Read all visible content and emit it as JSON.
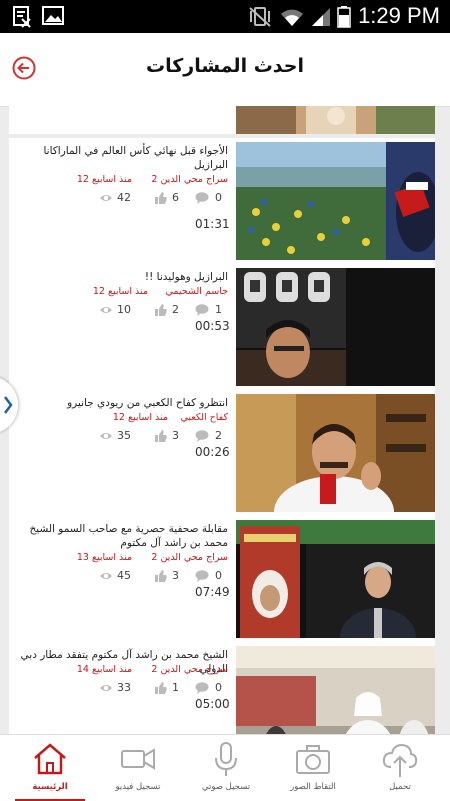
{
  "status_bar": {
    "time": "1:29 PM"
  },
  "header": {
    "title": "احدث المشاركات"
  },
  "posts": [
    {
      "title": "الأجواء قبل نهائي كأس العالم في الماراكانا البرازيل",
      "author": "سراج محي الدين 2",
      "age": "منذ اسابيع 12",
      "comments": "0",
      "likes": "6",
      "views": "42",
      "duration": "01:31"
    },
    {
      "title": "البرازيل وهوليدنا !!",
      "author": "جاسم الشحيمي",
      "age": "منذ اسابيع 12",
      "comments": "1",
      "likes": "2",
      "views": "10",
      "duration": "00:53"
    },
    {
      "title": "انتظرو كفاح الكعبي من ريودي جانيرو",
      "author": "كفاح الكعبي",
      "age": "منذ اسابيع 12",
      "comments": "2",
      "likes": "3",
      "views": "35",
      "duration": "00:26"
    },
    {
      "title": "مقابلة صحفية حصرية مع صاحب السمو الشيخ محمد بن راشد آل مكتوم",
      "author": "سراج محي الدين 2",
      "age": "منذ اسابيع 13",
      "comments": "0",
      "likes": "3",
      "views": "45",
      "duration": "07:49"
    },
    {
      "title": "الشيخ محمد بن راشد آل مكتوم يتفقد مطار دبي الدولي",
      "author": "سراج محي الدين 2",
      "age": "منذ اسابيع 14",
      "comments": "0",
      "likes": "1",
      "views": "33",
      "duration": "05:00"
    }
  ],
  "tabs": [
    {
      "label": "الرئيسية",
      "icon": "home-icon",
      "active": true
    },
    {
      "label": "تسجيل فيديو",
      "icon": "video-camera-icon",
      "active": false
    },
    {
      "label": "تسجيل صوتي",
      "icon": "microphone-icon",
      "active": false
    },
    {
      "label": "التقاط الصور",
      "icon": "camera-icon",
      "active": false
    },
    {
      "label": "تحميل",
      "icon": "cloud-upload-icon",
      "active": false
    }
  ],
  "colors": {
    "accent": "#c41a1a",
    "background": "#ececec",
    "status_bar": "#000000"
  }
}
